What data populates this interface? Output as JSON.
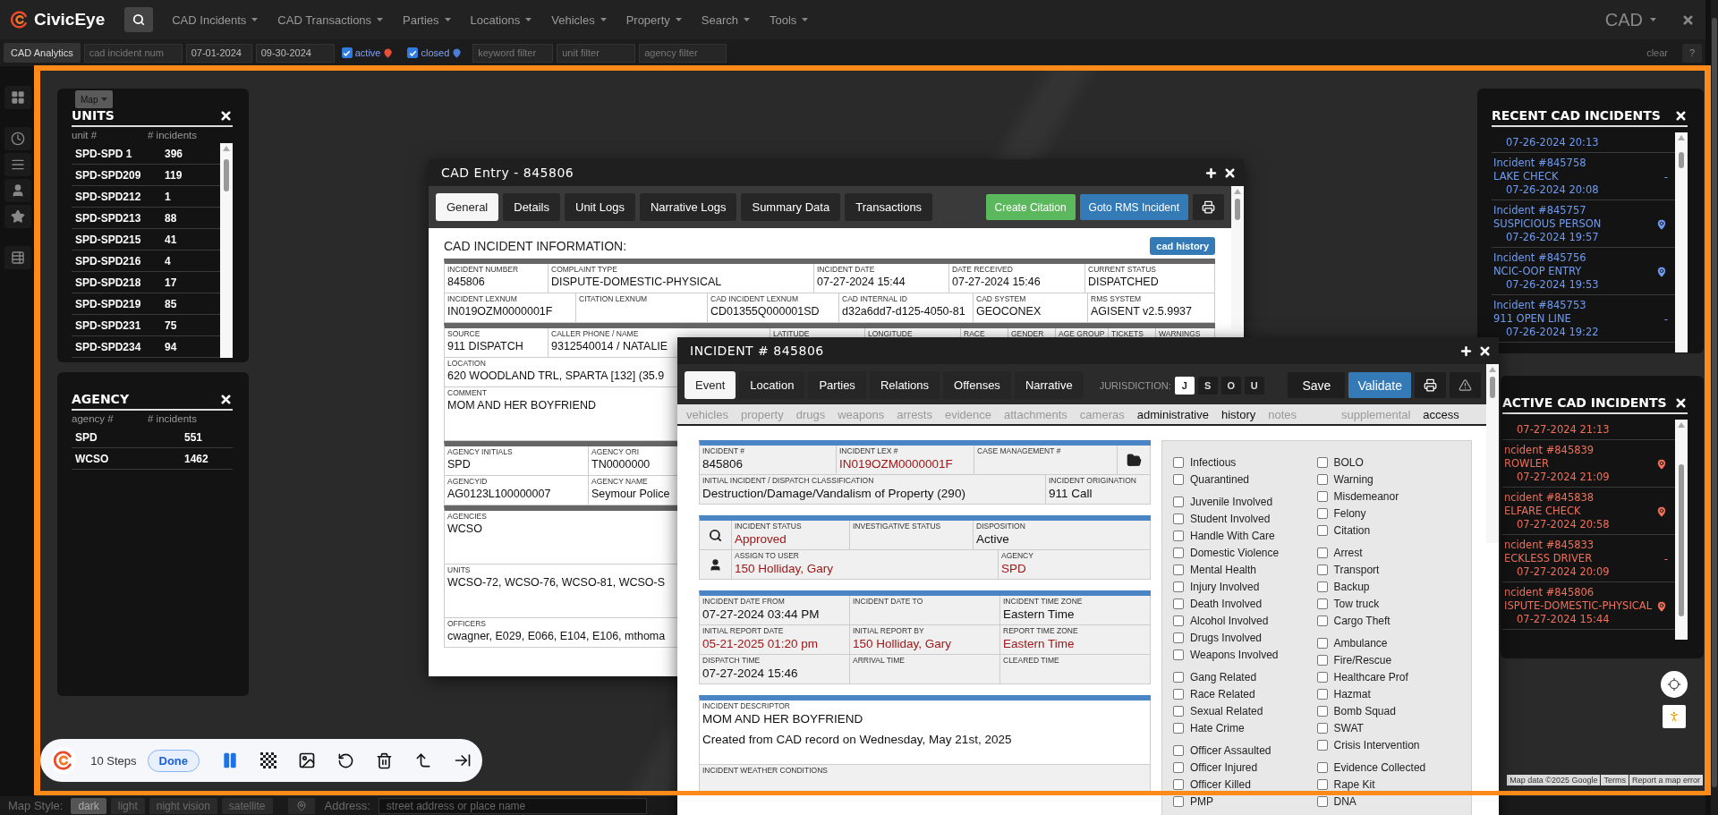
{
  "nav": {
    "logo": "CivicEye",
    "menus": [
      "CAD Incidents",
      "CAD Transactions",
      "Parties",
      "Locations",
      "Vehicles",
      "Property",
      "Search",
      "Tools"
    ],
    "context": "CAD"
  },
  "filter_bar": {
    "title": "CAD Analytics",
    "controls": [
      {
        "kind": "input",
        "placeholder": "cad incident num"
      },
      {
        "kind": "input",
        "value": "07-01-2024"
      },
      {
        "kind": "input",
        "value": "09-30-2024"
      },
      {
        "kind": "check",
        "label": "active",
        "checked": true,
        "color": "#e8503a"
      },
      {
        "kind": "check",
        "label": "closed",
        "checked": true,
        "color": "#4a7fd8"
      },
      {
        "kind": "input",
        "placeholder": "keyword filter"
      },
      {
        "kind": "input",
        "placeholder": "unit filter"
      },
      {
        "kind": "input",
        "placeholder": "agency filter"
      }
    ],
    "buttons": [
      "clear",
      "?"
    ]
  },
  "map": {
    "type_button": "Map",
    "attribution": [
      "Map data ©2025 Google",
      "Terms",
      "Report a map error"
    ]
  },
  "map_style_bar": {
    "label": "Map Style:",
    "styles": [
      {
        "label": "dark",
        "selected": true
      },
      {
        "label": "light",
        "selected": false
      },
      {
        "label": "night vision",
        "selected": false
      },
      {
        "label": "satellite",
        "selected": false
      }
    ],
    "address_label": "Address:",
    "address_placeholder": "street address or place name"
  },
  "units_panel": {
    "title": "UNITS",
    "columns": [
      "unit #",
      "# incidents"
    ],
    "rows": [
      [
        "SPD-SPD 1",
        "396"
      ],
      [
        "SPD-SPD209",
        "119"
      ],
      [
        "SPD-SPD212",
        "1"
      ],
      [
        "SPD-SPD213",
        "88"
      ],
      [
        "SPD-SPD215",
        "41"
      ],
      [
        "SPD-SPD216",
        "4"
      ],
      [
        "SPD-SPD218",
        "17"
      ],
      [
        "SPD-SPD219",
        "85"
      ],
      [
        "SPD-SPD231",
        "75"
      ],
      [
        "SPD-SPD234",
        "94"
      ]
    ]
  },
  "agency_panel": {
    "title": "AGENCY",
    "columns": [
      "agency #",
      "# incidents"
    ],
    "rows": [
      [
        "SPD",
        "551"
      ],
      [
        "WCSO",
        "1462"
      ]
    ]
  },
  "cad_window": {
    "title": "CAD Entry - 845806",
    "tabs": [
      {
        "label": "General",
        "selected": true
      },
      {
        "label": "Details",
        "selected": false
      },
      {
        "label": "Unit Logs",
        "selected": false
      },
      {
        "label": "Narrative Logs",
        "selected": false
      },
      {
        "label": "Summary Data",
        "selected": false
      },
      {
        "label": "Transactions",
        "selected": false
      }
    ],
    "actions": [
      {
        "kind": "citation",
        "label": "Create Citation"
      },
      {
        "kind": "rms",
        "label": "Goto RMS Incident"
      },
      {
        "kind": "print"
      }
    ],
    "heading": "CAD INCIDENT INFORMATION:",
    "history_button": "cad history",
    "groups": [
      {
        "bands": [
          {
            "kind": "field",
            "fields": [
              {
                "label": "INCIDENT NUMBER",
                "value": "845806"
              },
              {
                "label": "COMPLAINT TYPE",
                "value": "DISPUTE-DOMESTIC-PHYSICAL"
              },
              {
                "label": "INCIDENT DATE",
                "value": "07-27-2024 15:44"
              },
              {
                "label": "DATE RECEIVED",
                "value": "07-27-2024 15:46"
              },
              {
                "label": "CURRENT STATUS",
                "value": "DISPATCHED"
              }
            ]
          },
          {
            "kind": "field",
            "fields": [
              {
                "label": "INCIDENT LEXNUM",
                "value": "IN019OZM0000001F"
              },
              {
                "label": "CITATION LEXNUM"
              },
              {
                "label": "CAD INCIDENT LEXNUM",
                "value": "CD01355Q000001SD"
              },
              {
                "label": "CAD INTERNAL ID",
                "value": "d32a6dd7-d125-4050-81"
              },
              {
                "label": "CAD SYSTEM",
                "value": "GEOCONEX"
              },
              {
                "label": "RMS SYSTEM",
                "value": "AGISENT v2.5.9937"
              }
            ]
          }
        ]
      },
      {
        "bands": [
          {
            "kind": "field",
            "fields": [
              {
                "label": "SOURCE",
                "value": "911 DISPATCH"
              },
              {
                "label": "CALLER PHONE / NAME",
                "value": "9312540014 / NATALIE"
              },
              {
                "label": "LATITUDE"
              },
              {
                "label": "LONGITUDE"
              },
              {
                "label": "RACE"
              },
              {
                "label": "GENDER"
              },
              {
                "label": "AGE GROUP"
              },
              {
                "label": "TICKETS"
              },
              {
                "label": "WARNINGS"
              }
            ]
          },
          {
            "kind": "field",
            "fields": [
              {
                "label": "LOCATION",
                "value": "620 WOODLAND TRL, SPARTA [132] (35.9"
              }
            ]
          },
          {
            "kind": "memo",
            "fields": [
              {
                "label": "COMMENT",
                "value": "MOM AND HER BOYFRIEND"
              }
            ]
          }
        ]
      },
      {
        "bands": [
          {
            "kind": "field",
            "fields": [
              {
                "label": "AGENCY INITIALS",
                "value": "SPD"
              },
              {
                "label": "AGENCY ORI",
                "value": "TN0000000"
              }
            ]
          },
          {
            "kind": "field",
            "fields": [
              {
                "label": "AGENCYID",
                "value": "AG0123L100000007"
              },
              {
                "label": "AGENCY NAME",
                "value": "Seymour Police"
              }
            ]
          }
        ]
      },
      {
        "bands": [
          {
            "kind": "memo",
            "fields": [
              {
                "label": "AGENCIES",
                "value": "WCSO"
              }
            ]
          },
          {
            "kind": "memo",
            "fields": [
              {
                "label": "UNITS",
                "value": "WCSO-72, WCSO-76, WCSO-81, WCSO-S"
              }
            ]
          },
          {
            "kind": "field",
            "fields": [
              {
                "label": "OFFICERS",
                "value": "cwagner, E029, E066, E104, E106, mthoma"
              }
            ]
          }
        ]
      }
    ]
  },
  "incident_window": {
    "title": "INCIDENT # 845806",
    "tabs": [
      {
        "label": "Event",
        "selected": true
      },
      {
        "label": "Location",
        "selected": false
      },
      {
        "label": "Parties",
        "selected": false
      },
      {
        "label": "Relations",
        "selected": false
      },
      {
        "label": "Offenses",
        "selected": false
      },
      {
        "label": "Narrative",
        "selected": false
      }
    ],
    "jurisdiction": {
      "label": "JURISDICTION:",
      "options": [
        {
          "label": "J",
          "selected": true
        },
        {
          "label": "S",
          "selected": false
        },
        {
          "label": "O",
          "selected": false
        },
        {
          "label": "U",
          "selected": false
        }
      ]
    },
    "actions": [
      {
        "kind": "save",
        "label": "Save"
      },
      {
        "kind": "validate",
        "label": "Validate"
      },
      {
        "kind": "print"
      },
      {
        "kind": "warning"
      }
    ],
    "subtabs": [
      {
        "label": "vehicles",
        "disabled": true
      },
      {
        "label": "property",
        "disabled": true
      },
      {
        "label": "drugs",
        "disabled": true
      },
      {
        "label": "weapons",
        "disabled": true
      },
      {
        "label": "arrests",
        "disabled": true
      },
      {
        "label": "evidence",
        "disabled": true
      },
      {
        "label": "attachments",
        "disabled": true
      },
      {
        "label": "cameras",
        "disabled": true
      },
      {
        "label": "administrative",
        "disabled": false
      },
      {
        "label": "history",
        "disabled": false
      },
      {
        "label": "notes",
        "disabled": true
      }
    ],
    "subtabs_right": [
      {
        "label": "supplemental",
        "disabled": true
      },
      {
        "label": "access",
        "disabled": false
      }
    ],
    "sections": [
      {
        "bands": [
          {
            "fields": [
              {
                "kind": "field",
                "label": "INCIDENT #",
                "value": "845806",
                "highlighted": false
              },
              {
                "kind": "field",
                "label": "INCIDENT LEX #",
                "value": "IN019OZM0000001F",
                "highlighted": true
              },
              {
                "kind": "field",
                "label": "CASE MANAGEMENT #"
              },
              {
                "kind": "folder"
              }
            ]
          },
          {
            "fields": [
              {
                "kind": "field",
                "label": "INITIAL INCIDENT / DISPATCH CLASSIFICATION",
                "value": "Destruction/Damage/Vandalism of Property (290)",
                "highlighted": false
              },
              {
                "kind": "field",
                "label": "INCIDENT ORIGINATION",
                "value": "911 Call",
                "highlighted": false
              }
            ]
          }
        ]
      },
      {
        "bands": [
          {
            "fields": [
              {
                "kind": "field",
                "label": "INCIDENT STATUS",
                "value": "Approved",
                "highlighted": true
              },
              {
                "kind": "field",
                "label": "INVESTIGATIVE STATUS"
              },
              {
                "kind": "field",
                "label": "DISPOSITION",
                "value": "Active",
                "highlighted": false
              }
            ]
          },
          {
            "fields": [
              {
                "kind": "field",
                "label": "ASSIGN TO USER",
                "value": "150 Holliday, Gary",
                "highlighted": true
              },
              {
                "kind": "field",
                "label": "AGENCY",
                "value": "SPD",
                "highlighted": true
              }
            ]
          }
        ]
      },
      {
        "bands": [
          {
            "fields": [
              {
                "kind": "field",
                "label": "INCIDENT DATE FROM",
                "value": "07-27-2024 03:44 PM",
                "highlighted": false
              },
              {
                "kind": "field",
                "label": "INCIDENT DATE TO"
              },
              {
                "kind": "field",
                "label": "INCIDENT TIME ZONE",
                "value": "Eastern Time",
                "highlighted": false
              }
            ]
          },
          {
            "fields": [
              {
                "kind": "field",
                "label": "INITIAL REPORT DATE",
                "value": "05-21-2025 01:20 pm",
                "highlighted": true
              },
              {
                "kind": "field",
                "label": "INITIAL REPORT BY",
                "value": "150 Holliday, Gary",
                "highlighted": true
              },
              {
                "kind": "field",
                "label": "REPORT TIME ZONE",
                "value": "Eastern Time",
                "highlighted": true
              }
            ]
          },
          {
            "fields": [
              {
                "kind": "field",
                "label": "DISPATCH TIME",
                "value": "07-27-2024 15:46",
                "highlighted": false
              },
              {
                "kind": "field",
                "label": "ARRIVAL TIME"
              },
              {
                "kind": "field",
                "label": "CLEARED TIME"
              }
            ]
          }
        ]
      },
      {
        "bands": [
          {
            "fields": [
              {
                "kind": "field",
                "label": "INCIDENT DESCRIPTOR",
                "lines": [
                  "MOM AND HER BOYFRIEND",
                  "Created from CAD record on Wednesday, May 21st, 2025"
                ],
                "highlighted": false
              }
            ]
          },
          {
            "fields": [
              {
                "kind": "field",
                "label": "INCIDENT WEATHER CONDITIONS"
              }
            ]
          }
        ]
      }
    ],
    "flag_columns": [
      {
        "groups": [
          [
            {
              "label": "Infectious",
              "checked": false
            },
            {
              "label": "Quarantined",
              "checked": false
            }
          ],
          [
            {
              "label": "Juvenile Involved",
              "checked": false
            },
            {
              "label": "Student Involved",
              "checked": false
            },
            {
              "label": "Handle With Care",
              "checked": false
            },
            {
              "label": "Domestic Violence",
              "checked": false
            },
            {
              "label": "Mental Health",
              "checked": false
            },
            {
              "label": "Injury Involved",
              "checked": false
            },
            {
              "label": "Death Involved",
              "checked": false
            },
            {
              "label": "Alcohol Involved",
              "checked": false
            },
            {
              "label": "Drugs Involved",
              "checked": false
            },
            {
              "label": "Weapons Involved",
              "checked": false
            }
          ],
          [
            {
              "label": "Gang Related",
              "checked": false
            },
            {
              "label": "Race Related",
              "checked": false
            },
            {
              "label": "Sexual Related",
              "checked": false
            },
            {
              "label": "Hate Crime",
              "checked": false
            }
          ],
          [
            {
              "label": "Officer Assaulted",
              "checked": false
            },
            {
              "label": "Officer Injured",
              "checked": false
            },
            {
              "label": "Officer Killed",
              "checked": false
            },
            {
              "label": "PMP",
              "checked": false
            }
          ]
        ]
      },
      {
        "groups": [
          [
            {
              "label": "BOLO",
              "checked": false
            },
            {
              "label": "Warning",
              "checked": false
            },
            {
              "label": "Misdemeanor",
              "checked": false
            },
            {
              "label": "Felony",
              "checked": false
            },
            {
              "label": "Citation",
              "checked": false
            }
          ],
          [
            {
              "label": "Arrest",
              "checked": false
            },
            {
              "label": "Transport",
              "checked": false
            },
            {
              "label": "Backup",
              "checked": false
            },
            {
              "label": "Tow truck",
              "checked": false
            },
            {
              "label": "Cargo Theft",
              "checked": false
            }
          ],
          [
            {
              "label": "Ambulance",
              "checked": false
            },
            {
              "label": "Fire/Rescue",
              "checked": false
            },
            {
              "label": "Healthcare Prof",
              "checked": false
            },
            {
              "label": "Hazmat",
              "checked": false
            },
            {
              "label": "Bomb Squad",
              "checked": false
            },
            {
              "label": "SWAT",
              "checked": false
            },
            {
              "label": "Crisis Intervention",
              "checked": false
            }
          ],
          [
            {
              "label": "Evidence Collected",
              "checked": false
            },
            {
              "label": "Rape Kit",
              "checked": false
            },
            {
              "label": "DNA",
              "checked": false
            }
          ]
        ]
      }
    ]
  },
  "recent_panel": {
    "title": "RECENT CAD INCIDENTS",
    "items": [
      {
        "date": "07-26-2024 20:13"
      },
      {
        "incident": "Incident #845758",
        "type": "LAKE CHECK",
        "date": "07-26-2024 20:08",
        "kind": "text",
        "marker": "-"
      },
      {
        "incident": "Incident #845757",
        "type": "SUSPICIOUS PERSON",
        "date": "07-26-2024 19:57",
        "kind": "pin"
      },
      {
        "incident": "Incident #845756",
        "type": "NCIC-OOP ENTRY",
        "date": "07-26-2024 19:53",
        "kind": "pin"
      },
      {
        "incident": "Incident #845753",
        "type": "911 OPEN LINE",
        "date": "07-26-2024 19:22",
        "kind": "text",
        "marker": "-"
      }
    ]
  },
  "active_panel": {
    "title": "ACTIVE CAD INCIDENTS",
    "items": [
      {
        "date": "07-27-2024 21:13"
      },
      {
        "incident": "ncident #845839",
        "type": "ROWLER",
        "date": "07-27-2024 21:09",
        "kind": "pin"
      },
      {
        "incident": "ncident #845838",
        "type": "ELFARE CHECK",
        "date": "07-27-2024 20:58",
        "kind": "pin"
      },
      {
        "incident": "ncident #845833",
        "type": "ECKLESS DRIVER",
        "date": "07-27-2024 20:09",
        "kind": "text",
        "marker": "-"
      },
      {
        "incident": "ncident #845806",
        "type": "ISPUTE-DOMESTIC-PHYSICAL",
        "date": "07-27-2024 15:44",
        "kind": "pin"
      }
    ]
  },
  "recorder": {
    "steps": "10 Steps",
    "done": "Done"
  }
}
